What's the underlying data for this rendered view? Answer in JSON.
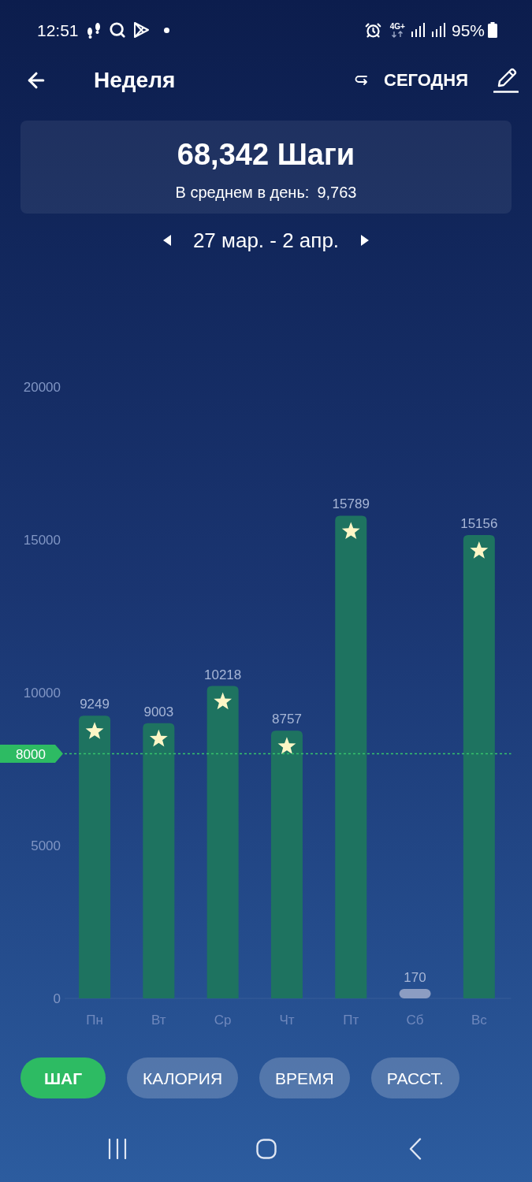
{
  "status_bar": {
    "time": "12:51",
    "network_type": "4G+",
    "battery": "95%"
  },
  "header": {
    "title": "Неделя",
    "today_button": "СЕГОДНЯ"
  },
  "summary": {
    "total": "68,342 Шаги",
    "average_label": "В среднем в день:",
    "average_value": "9,763"
  },
  "date_range": "27 мар. - 2 апр.",
  "chart": {
    "chart_data": {
      "type": "bar",
      "categories": [
        "Пн",
        "Вт",
        "Ср",
        "Чт",
        "Пт",
        "Сб",
        "Вс"
      ],
      "values": [
        9249,
        9003,
        10218,
        8757,
        15789,
        170,
        15156
      ],
      "ylim": [
        0,
        20000
      ],
      "yticks": [
        0,
        5000,
        10000,
        15000,
        20000
      ],
      "data_labels": true,
      "ref_lines": [
        {
          "axis": "y",
          "value": 8000,
          "label": "8000"
        }
      ]
    }
  },
  "metric_tabs": [
    {
      "label": "ШАГ",
      "selected": true
    },
    {
      "label": "КАЛОРИЯ",
      "selected": false
    },
    {
      "label": "ВРЕМЯ",
      "selected": false
    },
    {
      "label": "РАССТ.",
      "selected": false
    }
  ]
}
